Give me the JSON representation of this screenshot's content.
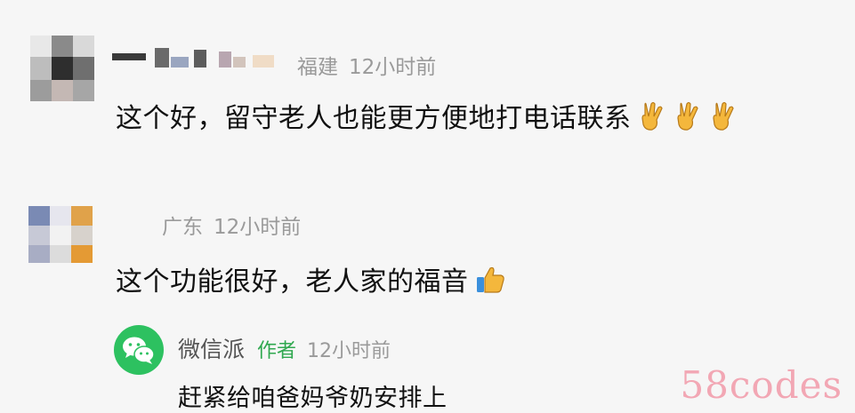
{
  "comments": [
    {
      "location": "福建",
      "time": "12小时前",
      "text": "这个好，留守老人也能更方便地打电话联系",
      "emoji": [
        "victory-hand-icon",
        "victory-hand-icon",
        "victory-hand-icon"
      ]
    },
    {
      "location": "广东",
      "time": "12小时前",
      "text": "这个功能很好，老人家的福音",
      "emoji": [
        "thumbs-up-icon"
      ],
      "reply": {
        "name": "微信派",
        "badge": "作者",
        "time": "12小时前",
        "text": "赶紧给咱爸妈爷奶安排上"
      }
    }
  ],
  "watermark": "58codes",
  "colors": {
    "background": "#f6f6f6",
    "author_badge": "#2fa84f",
    "wechat_green": "#2dc160",
    "watermark": "#f2a7b4"
  }
}
